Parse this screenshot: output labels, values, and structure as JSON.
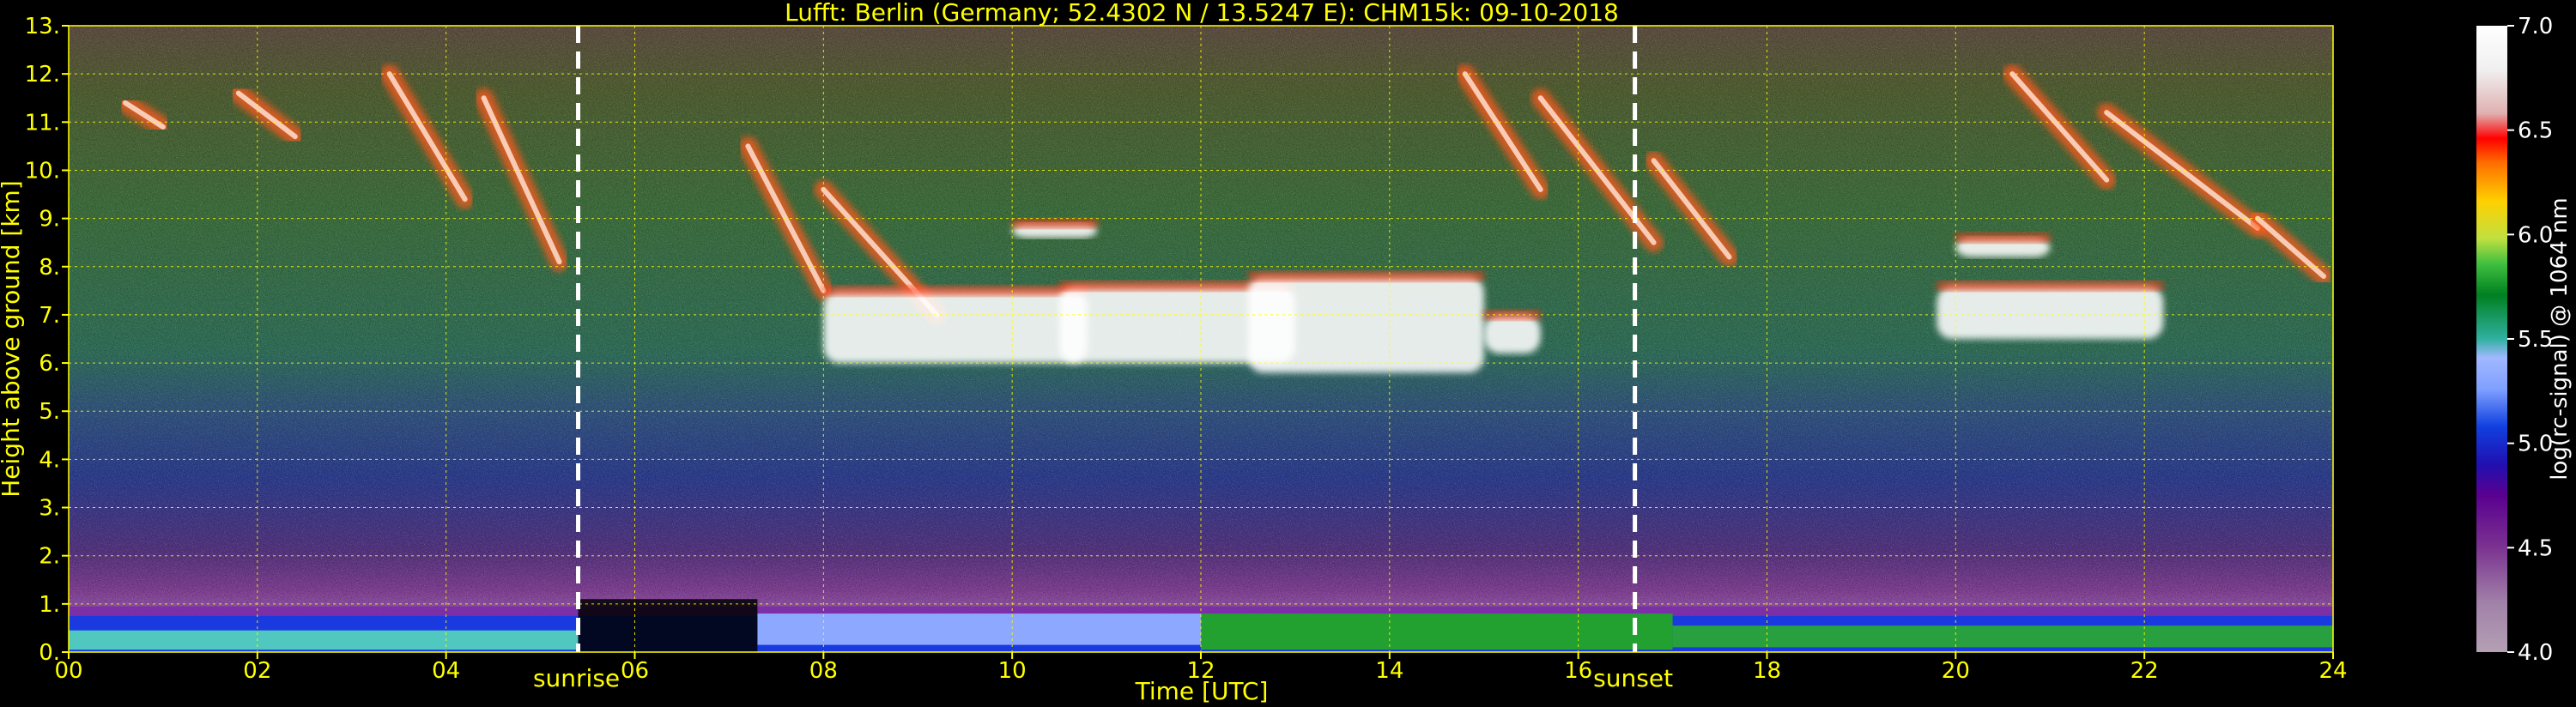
{
  "chart_data": {
    "type": "heatmap",
    "title": "Lufft: Berlin (Germany; 52.4302 N / 13.5247 E):    CHM15k: 09-10-2018",
    "xlabel": "Time [UTC]",
    "ylabel": "Height above ground [km]",
    "xlim": [
      0,
      24
    ],
    "ylim": [
      0,
      13
    ],
    "x_ticks": [
      0,
      2,
      4,
      6,
      8,
      10,
      12,
      14,
      16,
      18,
      20,
      22,
      24
    ],
    "x_tick_labels": [
      "00",
      "02",
      "04",
      "06",
      "08",
      "10",
      "12",
      "14",
      "16",
      "18",
      "20",
      "22",
      "24"
    ],
    "y_ticks": [
      0,
      1,
      2,
      3,
      4,
      5,
      6,
      7,
      8,
      9,
      10,
      11,
      12,
      13
    ],
    "y_tick_labels": [
      "0.",
      "1.",
      "2.",
      "3.",
      "4.",
      "5.",
      "6.",
      "7.",
      "8.",
      "9.",
      "10.",
      "11.",
      "12.",
      "13."
    ],
    "grid": true,
    "annotations": [
      {
        "label": "sunrise",
        "x": 5.4
      },
      {
        "label": "sunset",
        "x": 16.6
      }
    ],
    "colorbar": {
      "label": "log(rc-signal) @ 1064 nm",
      "range": [
        4.0,
        7.0
      ],
      "ticks": [
        4.0,
        4.5,
        5.0,
        5.5,
        6.0,
        6.5,
        7.0
      ],
      "tick_labels": [
        "4.0",
        "4.5",
        "5.0",
        "5.5",
        "6.0",
        "6.5",
        "7.0"
      ]
    }
  },
  "colors": {
    "background": "#000000",
    "text": "#ffff00",
    "grid": "#ffff00",
    "marker_line": "#ffffff"
  }
}
